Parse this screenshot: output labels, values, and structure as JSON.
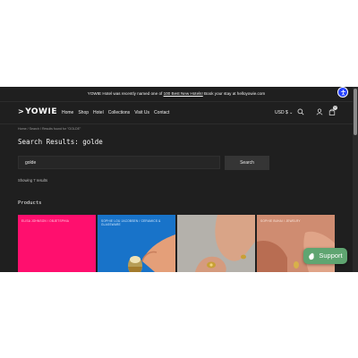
{
  "announcement": {
    "text_before": "YOWIE Hotel was recently named one of",
    "link": "100 Best New Hotels!",
    "text_after": "Book your stay at helloyowie.com"
  },
  "header": {
    "logo": "YOWIE",
    "nav": [
      "Home",
      "Shop",
      "Hotel",
      "Collections",
      "Visit Us",
      "Contact"
    ],
    "currency": "USD $",
    "cart_count": "0",
    "icons": [
      "search-icon",
      "account-icon",
      "cart-icon"
    ]
  },
  "breadcrumb": "Home  /  Search  /  Results found for \"GOLDE\"",
  "search": {
    "title": "Search Results: golde",
    "query": "golde",
    "button": "Search",
    "showing": "Showing 7 results"
  },
  "products": {
    "heading": "Products",
    "cards": [
      {
        "tag": "ELISA JOHNSON  /  OBJETSPHIA",
        "color": "#ff0f6e"
      },
      {
        "tag": "SOPHIE LOU JACOBSEN  /  CERAMICS & GLASSWARE",
        "color": "#1873c9"
      },
      {
        "tag": "",
        "color": "#b9b6b1"
      },
      {
        "tag": "SOPHIE BUHAI  /  JEWELRY",
        "color": "#d28f73"
      }
    ]
  },
  "support": {
    "label": "Support"
  },
  "colors": {
    "site_bg": "#1f1f1f",
    "support_green": "#5fa571",
    "accessibility_blue": "#2440ff"
  }
}
